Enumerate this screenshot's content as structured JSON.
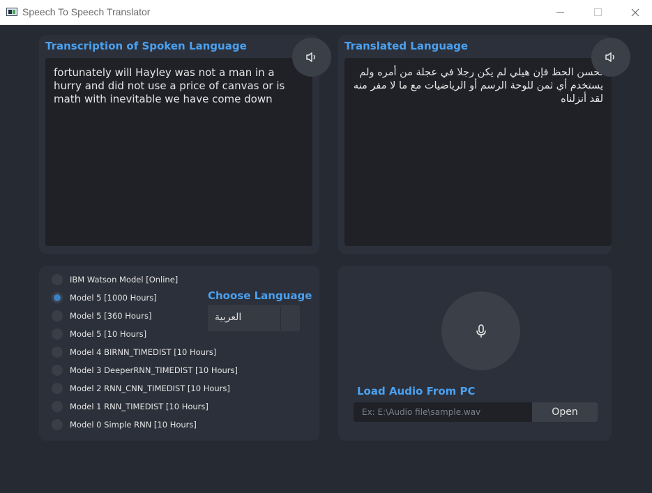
{
  "window": {
    "title": "Speech To Speech Translator"
  },
  "source": {
    "label": "Transcription of Spoken Language",
    "text": "fortunately will Hayley was not a man in a hurry and did not use a price of canvas or is math with inevitable we have come down",
    "speaker_icon": "speaker-icon"
  },
  "target": {
    "label": "Translated Language",
    "text": "لحسن الحظ فإن هيلي لم يكن رجلا في عجلة من أمره ولم يستخدم أي ثمن للوحة الرسم أو الرياضيات مع ما لا مفر منه لقد أنزلناه",
    "speaker_icon": "speaker-icon"
  },
  "models": {
    "selected_index": 1,
    "items": [
      "IBM Watson Model [Online]",
      "Model 5 [1000 Hours]",
      "Model 5 [360 Hours]",
      "Model 5 [10 Hours]",
      "Model 4 BIRNN_TIMEDIST [10 Hours]",
      "Model 3 DeeperRNN_TIMEDIST [10 Hours]",
      "Model 2 RNN_CNN_TIMEDIST [10 Hours]",
      "Model 1 RNN_TIMEDIST [10 Hours]",
      "Model 0 Simple RNN [10 Hours]"
    ]
  },
  "language": {
    "label": "Choose Language",
    "selected": "العربية"
  },
  "audio": {
    "mic_icon": "microphone-icon",
    "load_label": "Load Audio From PC",
    "path_placeholder": "Ex: E:\\Audio file\\sample.wav",
    "path_value": "",
    "open_label": "Open"
  },
  "colors": {
    "background": "#262a33",
    "panel": "#2c303a",
    "accent": "#4aa1f0",
    "text_area": "#1f2127"
  }
}
